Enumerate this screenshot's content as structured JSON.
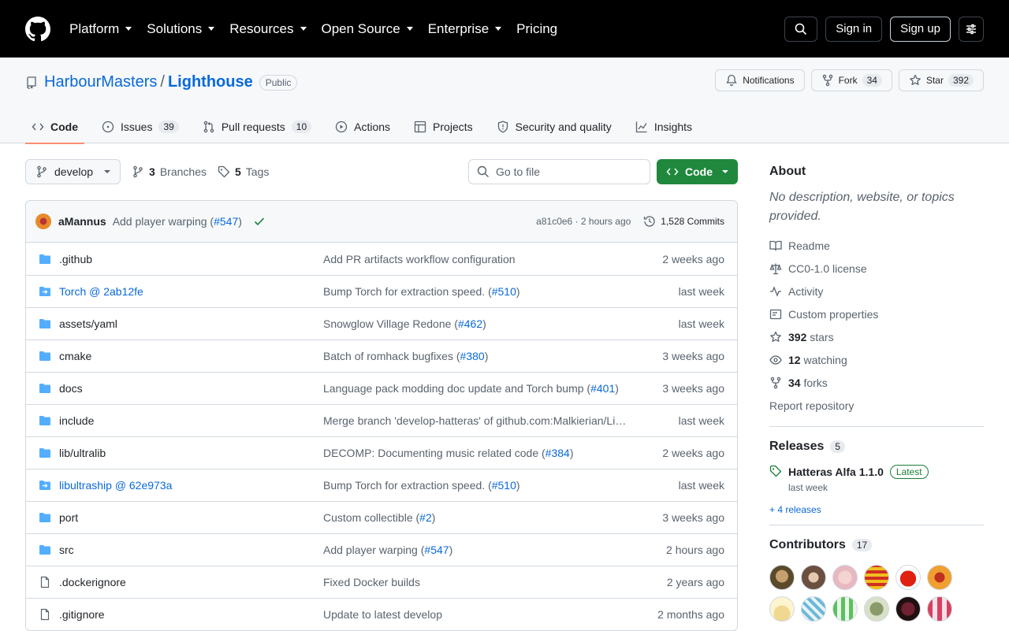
{
  "header": {
    "nav": [
      "Platform",
      "Solutions",
      "Resources",
      "Open Source",
      "Enterprise",
      "Pricing"
    ],
    "sign_in": "Sign in",
    "sign_up": "Sign up"
  },
  "repo": {
    "owner": "HarbourMasters",
    "slash": "/",
    "name": "Lighthouse",
    "visibility": "Public",
    "notifications_label": "Notifications",
    "fork_label": "Fork",
    "fork_count": "34",
    "star_label": "Star",
    "star_count": "392",
    "tabs": [
      {
        "label": "Code",
        "count": ""
      },
      {
        "label": "Issues",
        "count": "39"
      },
      {
        "label": "Pull requests",
        "count": "10"
      },
      {
        "label": "Actions",
        "count": ""
      },
      {
        "label": "Projects",
        "count": ""
      },
      {
        "label": "Security and quality",
        "count": ""
      },
      {
        "label": "Insights",
        "count": ""
      }
    ]
  },
  "toolbar": {
    "branch": "develop",
    "branches_count": "3",
    "branches_label": "Branches",
    "tags_count": "5",
    "tags_label": "Tags",
    "goto_placeholder": "Go to file",
    "code_label": "Code"
  },
  "latest_commit": {
    "author": "aMannus",
    "message": "Add player warping (",
    "pr": "#547",
    "message_end": ")",
    "sha": "a81c0e6",
    "dot": "·",
    "time": "2 hours ago",
    "commits": "1,528 Commits"
  },
  "files": [
    {
      "type": "dir",
      "name": ".github",
      "msg": "Add PR artifacts workflow configuration",
      "pr": "",
      "date": "2 weeks ago"
    },
    {
      "type": "submodule",
      "name": "Torch @ 2ab12fe",
      "msg": "Bump Torch for extraction speed. (",
      "pr": "#510",
      "date": "last week"
    },
    {
      "type": "dir",
      "name": "assets/yaml",
      "msg": "Snowglow Village Redone (",
      "pr": "#462",
      "date": "last week"
    },
    {
      "type": "dir",
      "name": "cmake",
      "msg": "Batch of romhack bugfixes (",
      "pr": "#380",
      "date": "3 weeks ago"
    },
    {
      "type": "dir",
      "name": "docs",
      "msg": "Language pack modding doc update and Torch bump (",
      "pr": "#401",
      "date": "3 weeks ago"
    },
    {
      "type": "dir",
      "name": "include",
      "msg": "Merge branch 'develop-hatteras' of github.com:Malkierian/Li…",
      "pr": "",
      "date": "last week"
    },
    {
      "type": "dir",
      "name": "lib/ultralib",
      "msg": "DECOMP: Documenting music related code (",
      "pr": "#384",
      "date": "2 weeks ago"
    },
    {
      "type": "submodule",
      "name": "libultraship @ 62e973a",
      "msg": "Bump Torch for extraction speed. (",
      "pr": "#510",
      "date": "last week"
    },
    {
      "type": "dir",
      "name": "port",
      "msg": "Custom collectible (",
      "pr": "#2",
      "date": "3 weeks ago"
    },
    {
      "type": "dir",
      "name": "src",
      "msg": "Add player warping (",
      "pr": "#547",
      "date": "2 hours ago"
    },
    {
      "type": "file",
      "name": ".dockerignore",
      "msg": "Fixed Docker builds",
      "pr": "",
      "date": "2 years ago"
    },
    {
      "type": "file",
      "name": ".gitignore",
      "msg": "Update to latest develop",
      "pr": "",
      "date": "2 months ago"
    }
  ],
  "about": {
    "heading": "About",
    "description": "No description, website, or topics provided.",
    "readme": "Readme",
    "license": "CC0-1.0 license",
    "activity": "Activity",
    "custom_properties": "Custom properties",
    "stars_count": "392",
    "stars_label": "stars",
    "watching_count": "12",
    "watching_label": "watching",
    "forks_count": "34",
    "forks_label": "forks",
    "report": "Report repository"
  },
  "releases": {
    "heading": "Releases",
    "count": "5",
    "latest_name": "Hatteras Alfa 1.1.0",
    "latest_badge": "Latest",
    "latest_date": "last week",
    "more": "+ 4 releases"
  },
  "contributors": {
    "heading": "Contributors",
    "count": "17"
  },
  "colors": {
    "accent": "#0969da",
    "green": "#1f883d",
    "tab_underline": "#fd8c73"
  }
}
